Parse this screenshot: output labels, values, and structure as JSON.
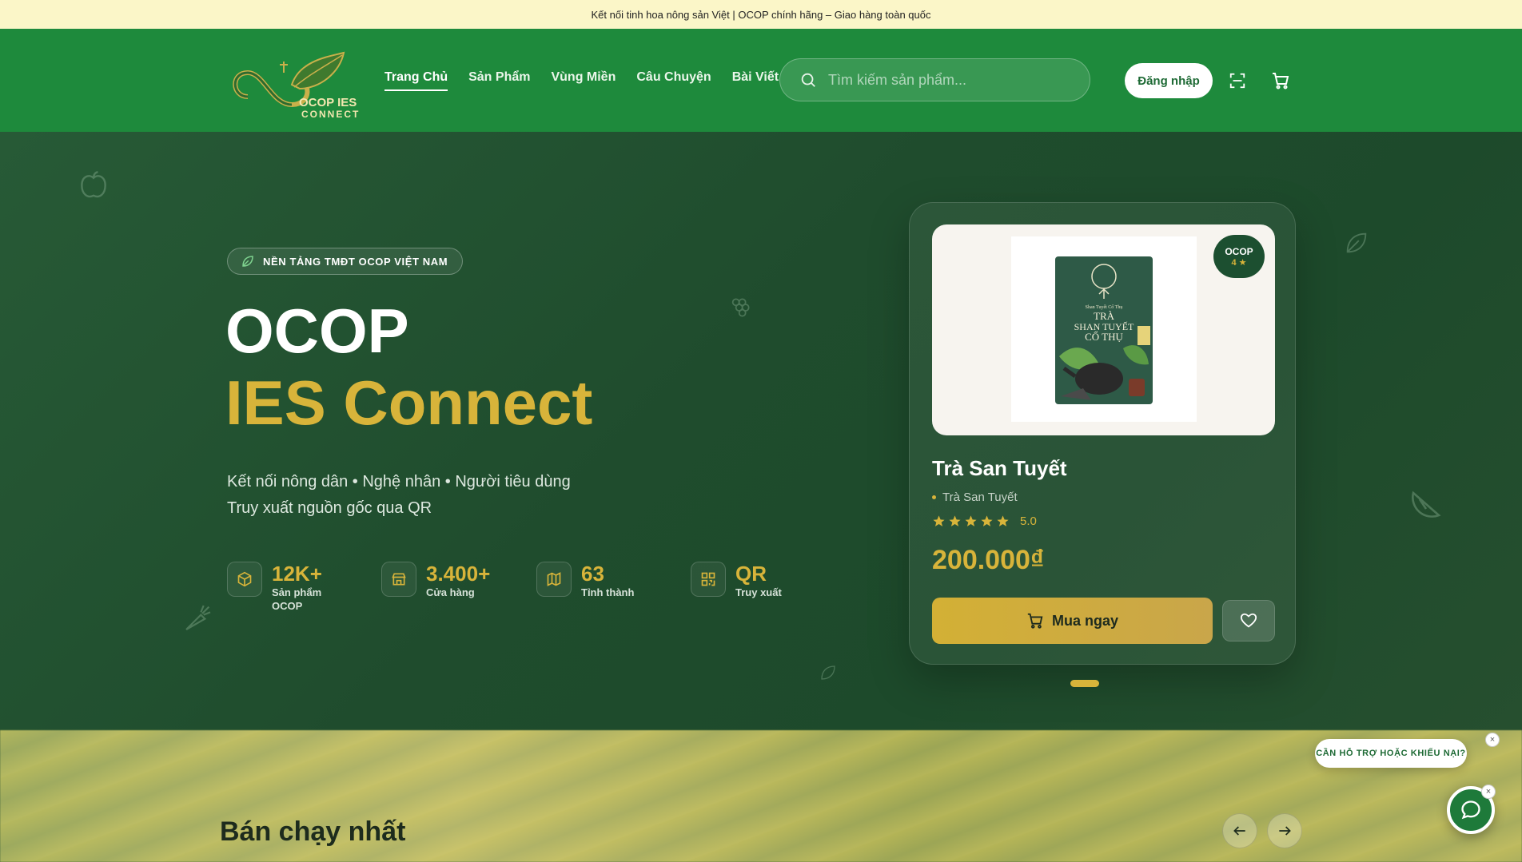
{
  "announcement": "Kết nối tinh hoa nông sản Việt | OCOP chính hãng – Giao hàng toàn quốc",
  "brand": {
    "logo_line1": "OCOP IES",
    "logo_line2": "CONNECT"
  },
  "nav": {
    "items": [
      {
        "label": "Trang Chủ",
        "active": true
      },
      {
        "label": "Sản Phẩm"
      },
      {
        "label": "Vùng Miền"
      },
      {
        "label": "Câu Chuyện"
      },
      {
        "label": "Bài Viết"
      }
    ],
    "search_placeholder": "Tìm kiếm sản phẩm...",
    "login_label": "Đăng nhập",
    "scan_icon": "scan-icon",
    "cart_icon": "cart-icon"
  },
  "hero": {
    "badge": "NỀN TẢNG TMĐT OCOP VIỆT NAM",
    "title_line1": "OCOP",
    "title_line2": "IES Connect",
    "subtitle_line1": "Kết nối nông dân • Nghệ nhân • Người tiêu dùng",
    "subtitle_line2": "Truy xuất nguồn gốc qua QR",
    "stats": [
      {
        "value": "12K+",
        "label": "Sản phẩm OCOP",
        "icon": "box-icon"
      },
      {
        "value": "3.400+",
        "label": "Cửa hàng",
        "icon": "store-icon"
      },
      {
        "value": "63",
        "label": "Tỉnh thành",
        "icon": "map-icon"
      },
      {
        "value": "QR",
        "label": "Truy xuất",
        "icon": "qr-icon"
      }
    ]
  },
  "featured": {
    "badge_title": "OCOP",
    "badge_stars": "4 ★",
    "package_brand": "Shan Tuyết Cổ Thụ",
    "package_title_1": "TRÀ",
    "package_title_2": "SHAN TUYẾT",
    "package_title_3": "CỔ THỤ",
    "name": "Trà San Tuyết",
    "category": "Trà San Tuyết",
    "rating": "5.0",
    "rating_value": 5,
    "price": "200.000₫",
    "buy_label": "Mua ngay"
  },
  "bestseller": {
    "title": "Bán chạy nhất"
  },
  "support": {
    "prompt": "CẦN HỖ TRỢ HOẶC KHIẾU NẠI?"
  },
  "colors": {
    "accent": "#d8b43a",
    "primary": "#1e8a3c",
    "hero_bg": "#1f4c2d",
    "announce_bg": "#fbf6c8"
  }
}
